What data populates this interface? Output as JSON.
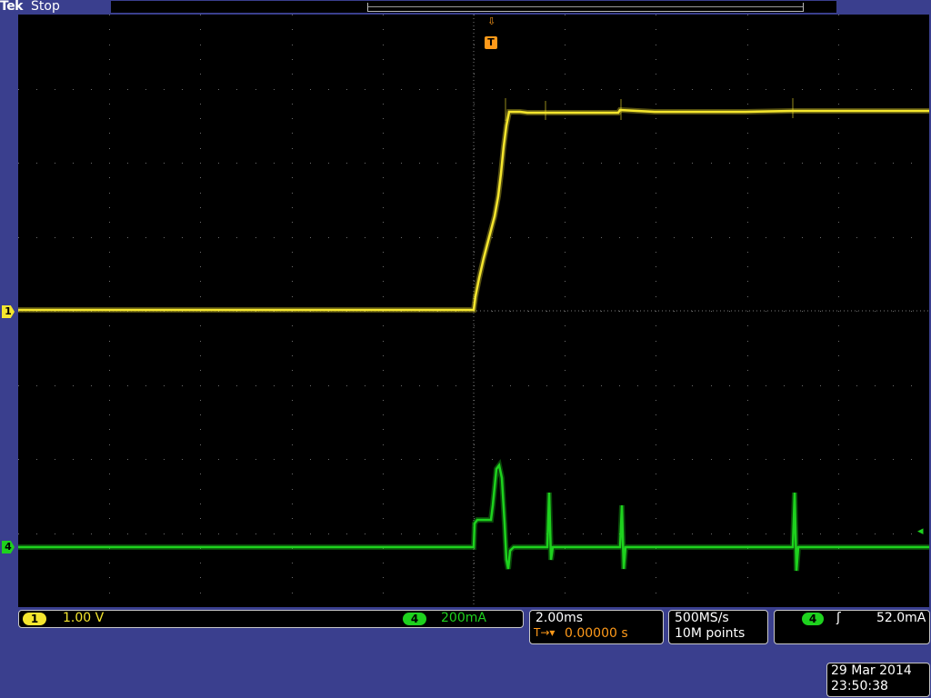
{
  "header": {
    "brand": "Tek",
    "status": "Stop"
  },
  "markers": {
    "trigger_position": "T",
    "trigger_arrow": "⇩",
    "channel1": "1",
    "channel4": "4",
    "trigger_level": "◂"
  },
  "readouts": {
    "ch1_badge": "1",
    "ch1_scale": "1.00 V",
    "ch4_badge": "4",
    "ch4_scale": "200mA",
    "timebase": "2.00ms",
    "trigger_delay_icon": "T→▾",
    "trigger_delay": "0.00000 s",
    "sample_rate": "500MS/s",
    "record_length": "10M points",
    "trigger_source_badge": "4",
    "trigger_slope": "ʃ",
    "trigger_level_value": "52.0mA",
    "date": "29 Mar 2014",
    "time": "23:50:38"
  },
  "colors": {
    "ch1": "#f5e62e",
    "ch4": "#1ed21e",
    "trigger": "#ff9a1a",
    "background": "#3a3f8e"
  }
}
